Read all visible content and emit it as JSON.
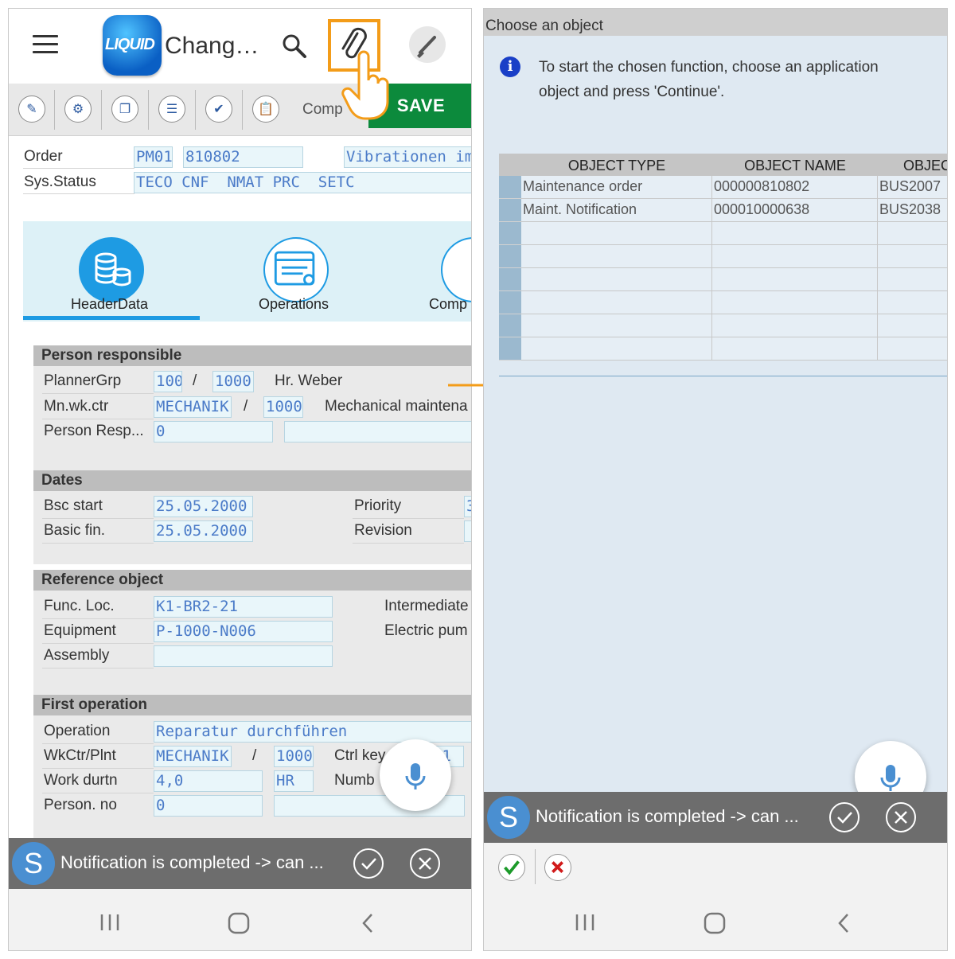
{
  "left": {
    "app": {
      "logo_text": "LIQUID",
      "title": "Chang…"
    },
    "toolbar": {
      "comp_label": "Comp",
      "save_label": "SAVE"
    },
    "header": {
      "order_label": "Order",
      "order_type": "PM01",
      "order_number": "810802",
      "order_desc": "Vibrationen im",
      "status_label": "Sys.Status",
      "status_value": "TECO CNF  NMAT PRC  SETC"
    },
    "tabs": [
      {
        "label": "HeaderData"
      },
      {
        "label": "Operations"
      },
      {
        "label": "Comp"
      }
    ],
    "person_responsible": {
      "title": "Person responsible",
      "planner_label": "PlannerGrp",
      "planner_grp": "100",
      "planner_plant": "1000",
      "planner_name": "Hr. Weber",
      "wkctr_label": "Mn.wk.ctr",
      "wkctr": "MECHANIK",
      "wkctr_plant": "1000",
      "wkctr_desc": "Mechanical maintena",
      "person_label": "Person Resp...",
      "person_value": "0",
      "person_desc": "",
      "slash": "/"
    },
    "dates": {
      "title": "Dates",
      "bsc_start_label": "Bsc start",
      "bsc_start": "25.05.2000",
      "basic_fin_label": "Basic fin.",
      "basic_fin": "25.05.2000",
      "priority_label": "Priority",
      "priority_value": "3",
      "revision_label": "Revision",
      "revision_value": ""
    },
    "reference_object": {
      "title": "Reference object",
      "func_loc_label": "Func. Loc.",
      "func_loc": "K1-BR2-21",
      "func_loc_desc": "Intermediate",
      "equipment_label": "Equipment",
      "equipment": "P-1000-N006",
      "equipment_desc": "Electric pum",
      "assembly_label": "Assembly",
      "assembly": ""
    },
    "first_operation": {
      "title": "First operation",
      "operation_label": "Operation",
      "operation": "Reparatur durchführen",
      "wkctr_label": "WkCtr/Plnt",
      "wkctr": "MECHANIK",
      "plant": "1000",
      "ctrl_key_label": "Ctrl key",
      "ctrl_key": "01",
      "work_label": "Work durtn",
      "work": "4,0",
      "work_unit": "HR",
      "number_label": "Numb",
      "person_label": "Person. no",
      "person": "0"
    },
    "statusbar": {
      "avatar": "S",
      "text": "Notification is completed -> can ..."
    }
  },
  "right": {
    "dialog_title": "Choose an object",
    "info_icon": "i",
    "info_text": "To start the chosen function, choose an application object and press 'Continue'.",
    "table": {
      "headers": [
        "OBJECT TYPE",
        "OBJECT NAME",
        "OBJEC"
      ],
      "rows": [
        [
          "Maintenance order",
          "000000810802",
          "BUS2007"
        ],
        [
          "Maint. Notification",
          "000010000638",
          "BUS2038"
        ],
        [
          "",
          "",
          ""
        ],
        [
          "",
          "",
          ""
        ],
        [
          "",
          "",
          ""
        ],
        [
          "",
          "",
          ""
        ],
        [
          "",
          "",
          ""
        ],
        [
          "",
          "",
          ""
        ]
      ]
    },
    "statusbar": {
      "avatar": "S",
      "text": "Notification is completed -> can ..."
    }
  },
  "colors": {
    "accent_orange": "#f39c19",
    "save_green": "#0c8a3c",
    "field_text": "#4b7bc8",
    "statusbar": "#6d6d6d"
  }
}
